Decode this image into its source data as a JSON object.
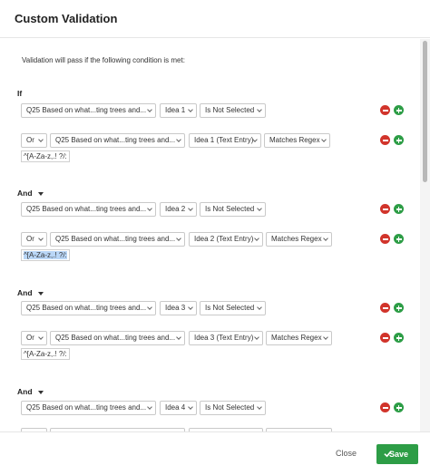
{
  "dialog": {
    "title": "Custom Validation"
  },
  "intro": "Validation will pass if the following condition is met:",
  "groups": [
    {
      "label": "If",
      "conditions": [
        {
          "question": "Q25 Based on what...ting trees and...",
          "field": "Idea 1",
          "operator": "Is Not Selected"
        },
        {
          "conjunction": "Or",
          "question": "Q25 Based on what...ting trees and...",
          "field": "Idea 1 (Text Entry)",
          "operator": "Matches Regex",
          "regex": "^[A-Za-z,.! ?/:"
        }
      ]
    },
    {
      "label": "And",
      "conditions": [
        {
          "question": "Q25 Based on what...ting trees and...",
          "field": "Idea 2",
          "operator": "Is Not Selected"
        },
        {
          "conjunction": "Or",
          "question": "Q25 Based on what...ting trees and...",
          "field": "Idea 2 (Text Entry)",
          "operator": "Matches Regex",
          "regex": "^[A-Za-z,.! ?/:"
        }
      ]
    },
    {
      "label": "And",
      "conditions": [
        {
          "question": "Q25 Based on what...ting trees and...",
          "field": "Idea 3",
          "operator": "Is Not Selected"
        },
        {
          "conjunction": "Or",
          "question": "Q25 Based on what...ting trees and...",
          "field": "Idea 3 (Text Entry)",
          "operator": "Matches Regex",
          "regex": "^[A-Za-z,.! ?/:"
        }
      ]
    },
    {
      "label": "And",
      "conditions": [
        {
          "question": "Q25 Based on what...ting trees and...",
          "field": "Idea 4",
          "operator": "Is Not Selected"
        }
      ]
    }
  ],
  "footer": {
    "close_label": "Close",
    "save_label": "Save"
  },
  "colors": {
    "remove": "#d1342b",
    "add": "#2d9d46",
    "save": "#2d9d46",
    "selection": "#b9d6f6"
  }
}
